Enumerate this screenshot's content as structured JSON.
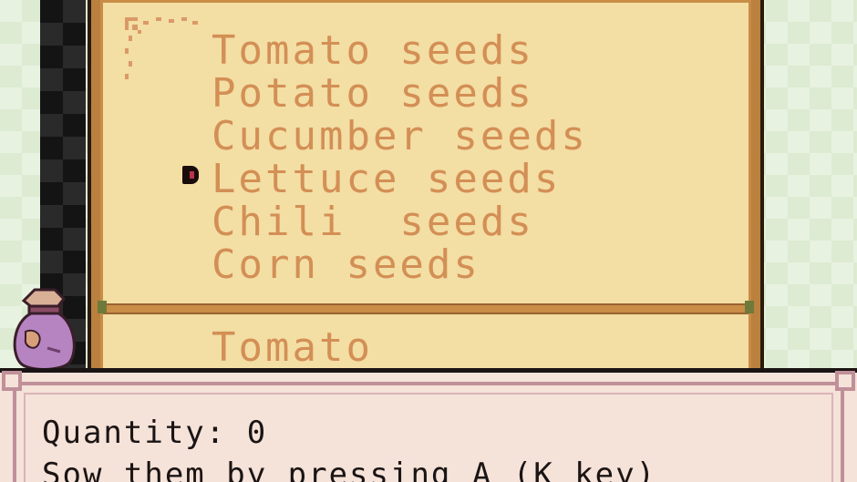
{
  "seed_menu": {
    "items": [
      {
        "label": "Tomato seeds"
      },
      {
        "label": "Potato seeds"
      },
      {
        "label": "Cucumber seeds"
      },
      {
        "label": "Lettuce seeds",
        "selected": true
      },
      {
        "label": "Chili  seeds"
      },
      {
        "label": "Corn seeds"
      }
    ],
    "detail_name": "Tomato"
  },
  "dialog": {
    "quantity_line": "Quantity: 0",
    "hint_line": "Sow them by pressing A (K key)"
  },
  "colors": {
    "menu_text": "#d38f55",
    "menu_bg": "#f3dea4",
    "menu_border": "#b9803e",
    "dialog_bg": "#f5e2d8",
    "dialog_frame": "#c0909a",
    "dialog_text": "#1a1414"
  },
  "icons": {
    "cursor": "selection-arrow-icon",
    "bag": "seed-bag-icon"
  }
}
